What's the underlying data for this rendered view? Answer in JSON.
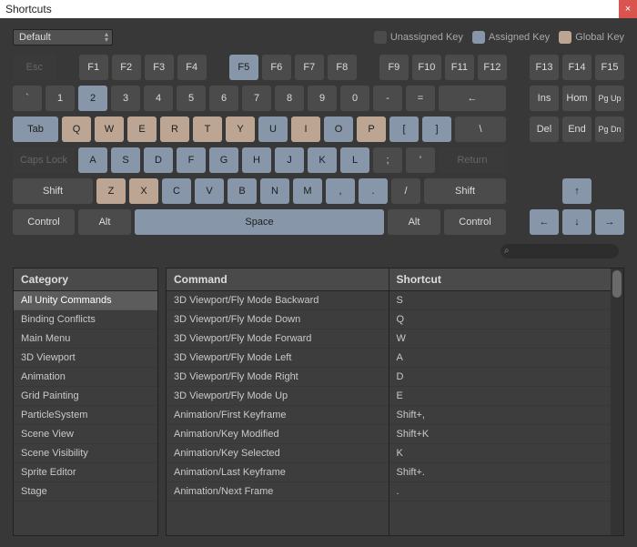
{
  "window": {
    "title": "Shortcuts"
  },
  "profile": {
    "label": "Default"
  },
  "legend": {
    "unassigned": "Unassigned Key",
    "assigned": "Assigned Key",
    "global": "Global Key"
  },
  "keys": {
    "esc": "Esc",
    "f1": "F1",
    "f2": "F2",
    "f3": "F3",
    "f4": "F4",
    "f5": "F5",
    "f6": "F6",
    "f7": "F7",
    "f8": "F8",
    "f9": "F9",
    "f10": "F10",
    "f11": "F11",
    "f12": "F12",
    "f13": "F13",
    "f14": "F14",
    "f15": "F15",
    "backtick": "`",
    "n1": "1",
    "n2": "2",
    "n3": "3",
    "n4": "4",
    "n5": "5",
    "n6": "6",
    "n7": "7",
    "n8": "8",
    "n9": "9",
    "n0": "0",
    "minus": "-",
    "equals": "=",
    "backspace": "←",
    "tab": "Tab",
    "q": "Q",
    "w": "W",
    "e": "E",
    "r": "R",
    "t": "T",
    "y": "Y",
    "u": "U",
    "i": "I",
    "o": "O",
    "p": "P",
    "lbr": "[",
    "rbr": "]",
    "bslash": "\\",
    "caps": "Caps Lock",
    "a": "A",
    "s": "S",
    "d": "D",
    "f": "F",
    "g": "G",
    "h": "H",
    "j": "J",
    "k": "K",
    "l": "L",
    "semi": ";",
    "quote": "'",
    "return": "Return",
    "lshift": "Shift",
    "z": "Z",
    "x": "X",
    "c": "C",
    "v": "V",
    "b": "B",
    "n": "N",
    "m": "M",
    "comma": ",",
    "period": ".",
    "slash": "/",
    "rshift": "Shift",
    "lctrl": "Control",
    "lalt": "Alt",
    "space": "Space",
    "ralt": "Alt",
    "rctrl": "Control",
    "ins": "Ins",
    "home": "Hom",
    "pgup": "Pg Up",
    "del": "Del",
    "end": "End",
    "pgdn": "Pg Dn",
    "up": "↑",
    "left": "←",
    "down": "↓",
    "right": "→"
  },
  "category": {
    "header": "Category",
    "items": [
      "All Unity Commands",
      "Binding Conflicts",
      "Main Menu",
      "3D Viewport",
      "Animation",
      "Grid Painting",
      "ParticleSystem",
      "Scene View",
      "Scene Visibility",
      "Sprite Editor",
      "Stage"
    ],
    "selected": 0
  },
  "commands": {
    "header": "Command",
    "shortcut_header": "Shortcut",
    "rows": [
      {
        "cmd": "3D Viewport/Fly Mode Backward",
        "sc": "S"
      },
      {
        "cmd": "3D Viewport/Fly Mode Down",
        "sc": "Q"
      },
      {
        "cmd": "3D Viewport/Fly Mode Forward",
        "sc": "W"
      },
      {
        "cmd": "3D Viewport/Fly Mode Left",
        "sc": "A"
      },
      {
        "cmd": "3D Viewport/Fly Mode Right",
        "sc": "D"
      },
      {
        "cmd": "3D Viewport/Fly Mode Up",
        "sc": "E"
      },
      {
        "cmd": "Animation/First Keyframe",
        "sc": "Shift+,"
      },
      {
        "cmd": "Animation/Key Modified",
        "sc": "Shift+K"
      },
      {
        "cmd": "Animation/Key Selected",
        "sc": "K"
      },
      {
        "cmd": "Animation/Last Keyframe",
        "sc": "Shift+."
      },
      {
        "cmd": "Animation/Next Frame",
        "sc": "."
      }
    ]
  },
  "search": {
    "placeholder": ""
  }
}
